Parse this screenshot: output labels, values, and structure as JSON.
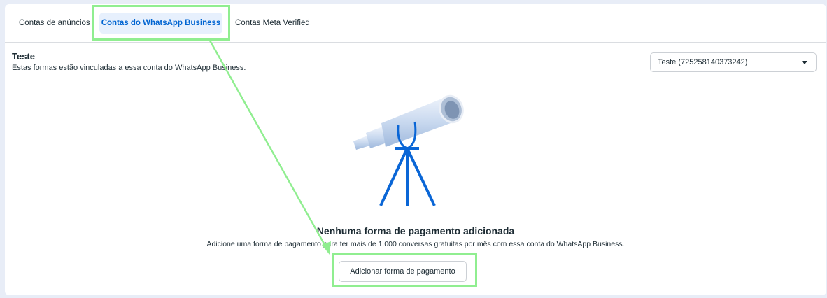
{
  "tabs": [
    {
      "label": "Contas de anúncios",
      "active": false
    },
    {
      "label": "Contas do WhatsApp Business",
      "active": true
    },
    {
      "label": "Contas Meta Verified",
      "active": false
    }
  ],
  "section": {
    "title": "Teste",
    "subtitle": "Estas formas estão vinculadas a essa conta do WhatsApp Business."
  },
  "account_select": {
    "selected": "Teste (725258140373242)"
  },
  "empty_state": {
    "illustration": "telescope-illustration",
    "title": "Nenhuma forma de pagamento adicionada",
    "description": "Adicione uma forma de pagamento para ter mais de 1.000 conversas gratuitas por mês com essa conta do WhatsApp Business.",
    "button_label": "Adicionar forma de pagamento"
  },
  "annotation": {
    "highlight_color": "#90ee90"
  },
  "colors": {
    "accent": "#0064d1",
    "active_tab_bg": "#e7f0fd",
    "telescope_body": "#c5d7f0",
    "telescope_stand": "#0a66d6"
  }
}
